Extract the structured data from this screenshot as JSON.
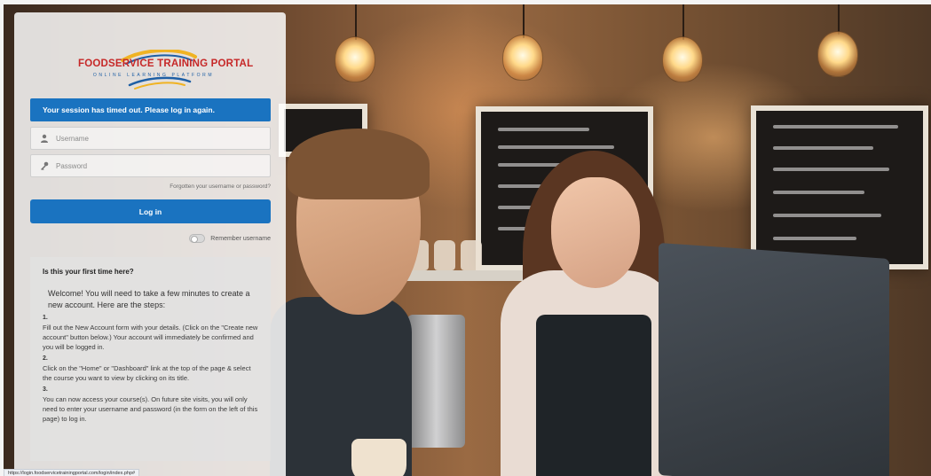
{
  "logo": {
    "brand": "FOODSERVICE TRAINING PORTAL",
    "tagline": "ONLINE LEARNING PLATFORM",
    "colors": {
      "red": "#c62828",
      "blue": "#1e5fa5",
      "gold": "#f0b323"
    }
  },
  "alert": {
    "message": "Your session has timed out. Please log in again."
  },
  "login": {
    "username": {
      "placeholder": "Username",
      "icon": "user-icon"
    },
    "password": {
      "placeholder": "Password",
      "icon": "key-icon"
    },
    "forgot_link": "Forgotten your username or password?",
    "submit_label": "Log in",
    "remember_label": "Remember username",
    "remember_checked": false
  },
  "info": {
    "heading": "Is this your first time here?",
    "welcome": "Welcome! You will need to take a few minutes to create a new account.  Here are the steps:",
    "steps": [
      {
        "number": "1.",
        "text": "Fill out the New Account form with your details. (Click on the \"Create new account\" button below.) Your account will immediately be confirmed and you will be logged in."
      },
      {
        "number": "2.",
        "text": "Click on the \"Home\" or \"Dashboard\" link at the top of the page & select the course you want to view by clicking on its title."
      },
      {
        "number": "3.",
        "text": "You can now access your course(s). On future site visits, you will only need to enter your username and password (in the form on the left of this page) to log in."
      }
    ]
  },
  "status_bar": {
    "url": "https://login.foodservicetrainingportal.com/login/index.php#"
  },
  "theme": {
    "primary": "#1a73c0"
  }
}
